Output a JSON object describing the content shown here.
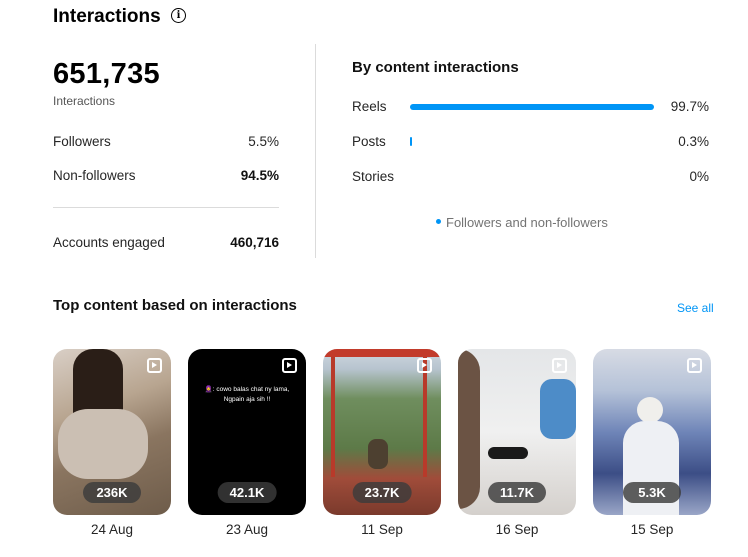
{
  "header": {
    "title": "Interactions",
    "info_icon": "info-icon"
  },
  "summary": {
    "total": "651,735",
    "total_label": "Interactions",
    "followers_label": "Followers",
    "followers_value": "5.5%",
    "non_followers_label": "Non-followers",
    "non_followers_value": "94.5%",
    "accounts_label": "Accounts engaged",
    "accounts_value": "460,716"
  },
  "by_content": {
    "title": "By content interactions",
    "items": [
      {
        "label": "Reels",
        "value": "99.7%",
        "fraction": 0.997
      },
      {
        "label": "Posts",
        "value": "0.3%",
        "fraction": 0.003
      },
      {
        "label": "Stories",
        "value": "0%",
        "fraction": 0
      }
    ],
    "legend": "Followers and non-followers",
    "bar_color": "#0095f6"
  },
  "top_content": {
    "title": "Top content based on interactions",
    "see_all": "See all",
    "items": [
      {
        "count": "236K",
        "date": "24 Aug",
        "overlay_text": ""
      },
      {
        "count": "42.1K",
        "date": "23 Aug",
        "overlay_text": "🧕: cowo balas chat ny lama, Ngpain aja sih !!"
      },
      {
        "count": "23.7K",
        "date": "11 Sep",
        "overlay_text": ""
      },
      {
        "count": "11.7K",
        "date": "16 Sep",
        "overlay_text": ""
      },
      {
        "count": "5.3K",
        "date": "15 Sep",
        "overlay_text": ""
      }
    ]
  }
}
